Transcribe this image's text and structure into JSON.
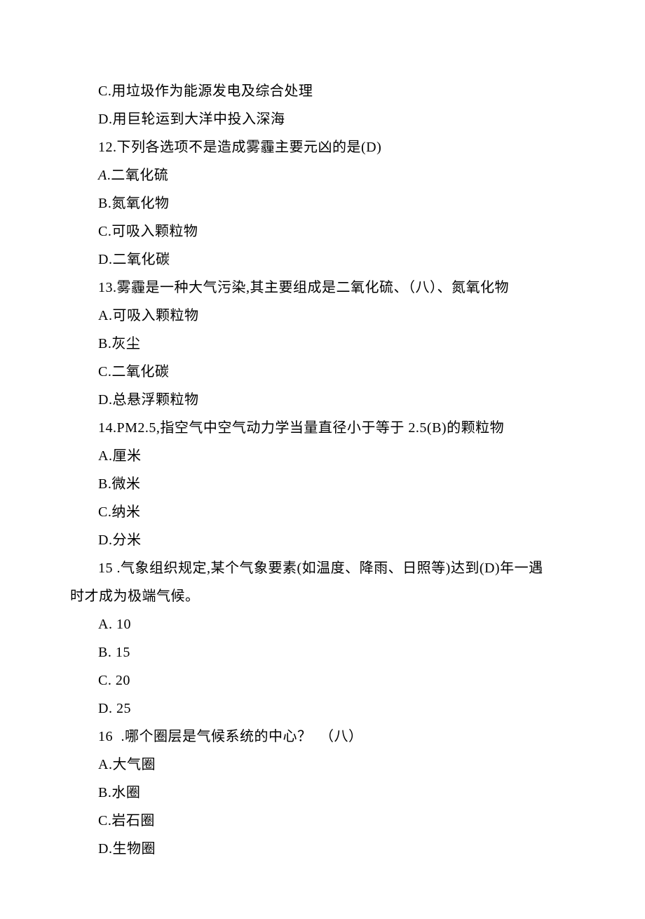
{
  "lines": [
    {
      "text": "C.用垃圾作为能源发电及综合处理",
      "hanging": false
    },
    {
      "text": "D.用巨轮运到大洋中投入深海",
      "hanging": false
    },
    {
      "text": "12.下列各选项不是造成雾霾主要元凶的是(D)",
      "hanging": false
    },
    {
      "text": "A.二氧化硫",
      "hanging": false,
      "italicPrefix": true
    },
    {
      "text": "B.氮氧化物",
      "hanging": false
    },
    {
      "text": "C.可吸入颗粒物",
      "hanging": false
    },
    {
      "text": "D.二氧化碳",
      "hanging": false
    },
    {
      "text": "13.雾霾是一种大气污染,其主要组成是二氧化硫、（八）、氮氧化物",
      "hanging": false
    },
    {
      "text": "A.可吸入颗粒物",
      "hanging": false
    },
    {
      "text": "B.灰尘",
      "hanging": false
    },
    {
      "text": "C.二氧化碳",
      "hanging": false
    },
    {
      "text": "D.总悬浮颗粒物",
      "hanging": false
    },
    {
      "text": "14.PM2.5,指空气中空气动力学当量直径小于等于 2.5(B)的颗粒物",
      "hanging": false
    },
    {
      "text": "A.厘米",
      "hanging": false
    },
    {
      "text": "B.微米",
      "hanging": false
    },
    {
      "text": "C.纳米",
      "hanging": false
    },
    {
      "text": "D.分米",
      "hanging": false
    },
    {
      "text": "15 .气象组织规定,某个气象要素(如温度、降雨、日照等)达到(D)年一遇",
      "hanging": false
    },
    {
      "text": "时才成为极端气候。",
      "hanging": true
    },
    {
      "text": "A. 10",
      "hanging": false
    },
    {
      "text": "B. 15",
      "hanging": false
    },
    {
      "text": "C. 20",
      "hanging": false
    },
    {
      "text": "D. 25",
      "hanging": false
    },
    {
      "text": "16   .哪个圈层是气候系统的中心？ （八）",
      "hanging": false,
      "wideGap": true
    },
    {
      "text": "A.大气圈",
      "hanging": false
    },
    {
      "text": "B.水圈",
      "hanging": false
    },
    {
      "text": "C.岩石圈",
      "hanging": false
    },
    {
      "text": "D.生物圈",
      "hanging": false
    }
  ]
}
